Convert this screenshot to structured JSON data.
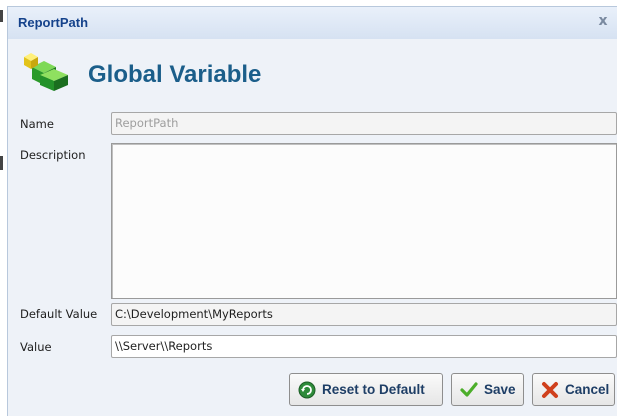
{
  "window": {
    "title": "ReportPath",
    "close_glyph": "x"
  },
  "header": {
    "icon": "green-cube-icon",
    "title": "Global Variable"
  },
  "form": {
    "name_label": "Name",
    "name_value": "ReportPath",
    "description_label": "Description",
    "description_value": "",
    "default_value_label": "Default Value",
    "default_value": "C:\\Development\\MyReports",
    "value_label": "Value",
    "value": "\\\\Server\\\\Reports"
  },
  "buttons": {
    "reset_label": "Reset to Default",
    "save_label": "Save",
    "cancel_label": "Cancel"
  },
  "colors": {
    "title_text": "#15428b",
    "heading_text": "#1b5e8a",
    "button_text": "#1e3e66",
    "reset_icon": "#2e8b3a",
    "save_icon": "#4cae2a",
    "cancel_icon": "#d0401c"
  }
}
